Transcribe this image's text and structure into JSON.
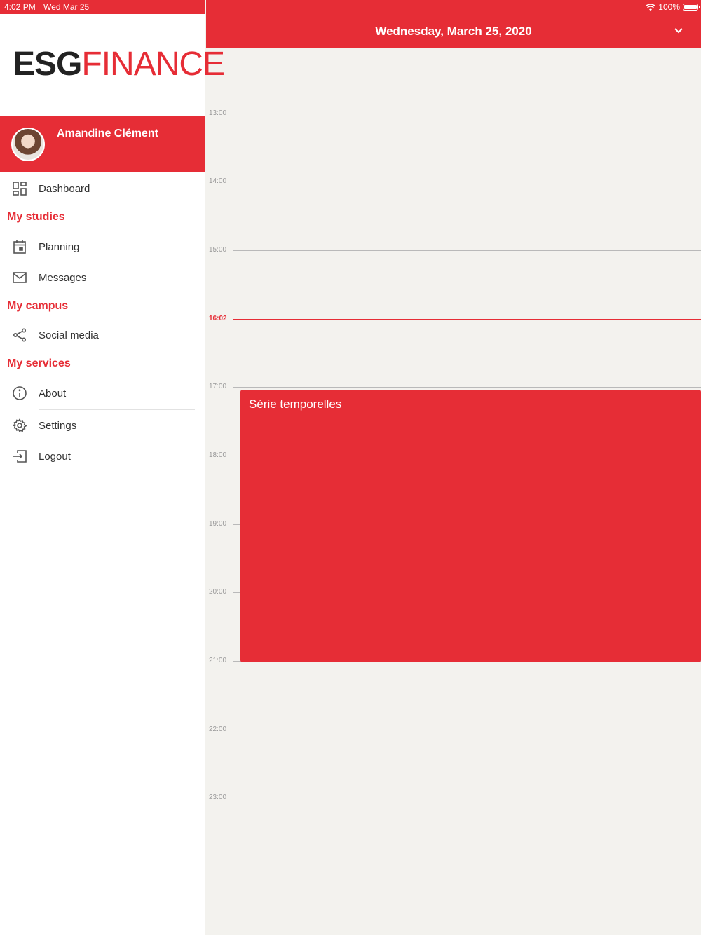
{
  "status_bar": {
    "time": "4:02 PM",
    "date": "Wed Mar 25",
    "battery": "100%"
  },
  "sidebar": {
    "logo": {
      "part1": "ESG",
      "part2": "FINANCE"
    },
    "user_name": "Amandine Clément",
    "dashboard": "Dashboard",
    "sections": {
      "studies": "My studies",
      "campus": "My campus",
      "services": "My services"
    },
    "items": {
      "planning": "Planning",
      "messages": "Messages",
      "social": "Social media",
      "about": "About",
      "settings": "Settings",
      "logout": "Logout"
    }
  },
  "header": {
    "title": "Wednesday, March 25, 2020"
  },
  "timeline": {
    "hours": [
      "13:00",
      "14:00",
      "15:00",
      "16:02",
      "17:00",
      "18:00",
      "19:00",
      "20:00",
      "21:00",
      "22:00",
      "23:00"
    ],
    "current_time": "16:02"
  },
  "event": {
    "title": "Série temporelles"
  },
  "colors": {
    "brand": "#e62d36",
    "background": "#f3f2ee"
  }
}
